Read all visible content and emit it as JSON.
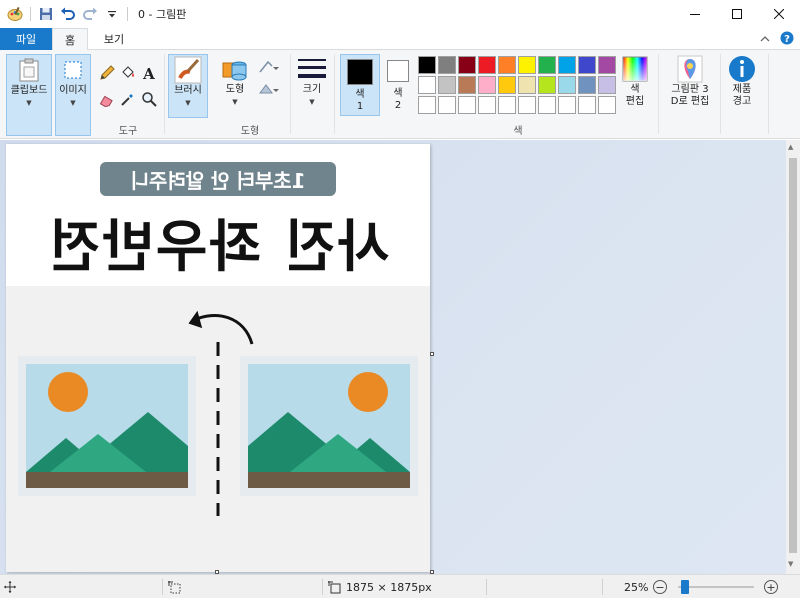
{
  "window": {
    "title": "0 - 그림판"
  },
  "tabs": {
    "file": "파일",
    "home": "홈",
    "view": "보기"
  },
  "ribbon": {
    "clipboard_label": "클립보드",
    "image_label": "이미지",
    "tools_group": "도구",
    "brushes_label": "브러시",
    "shapes_label": "도형",
    "shapes_group": "도형",
    "size_label": "크기",
    "color1_label": "색\n1",
    "color1_line1": "색",
    "color1_line2": "1",
    "color2_line1": "색",
    "color2_line2": "2",
    "colors_group": "색",
    "edit_colors_line1": "색",
    "edit_colors_line2": "편집",
    "paint3d_line1": "그림판 3",
    "paint3d_line2": "D로 편집",
    "product_alert_line1": "제품",
    "product_alert_line2": "경고",
    "color1_value": "#000000",
    "color2_value": "#ffffff",
    "palette": [
      "#000000",
      "#7f7f7f",
      "#880015",
      "#ed1c24",
      "#ff7f27",
      "#fff200",
      "#22b14c",
      "#00a2e8",
      "#3f48cc",
      "#a349a4",
      "#ffffff",
      "#c3c3c3",
      "#b97a57",
      "#ffaec9",
      "#ffc90e",
      "#efe4b0",
      "#b5e61d",
      "#99d9ea",
      "#7092be",
      "#c8bfe7",
      "#ffffff",
      "#ffffff",
      "#ffffff",
      "#ffffff",
      "#ffffff",
      "#ffffff",
      "#ffffff",
      "#ffffff",
      "#ffffff",
      "#ffffff"
    ]
  },
  "image": {
    "subtitle": "1초부터 안 알려주니",
    "title": "사진 좌우반전",
    "sun_color": "#e98a24",
    "sky_color": "#b7dbe8",
    "mountain_dark": "#1e8a6c",
    "mountain_light": "#2fa882",
    "ground_color": "#6e5b46"
  },
  "status": {
    "image_size": "1875 × 1875px",
    "zoom": "25%",
    "zoom_fraction": 0.25
  }
}
